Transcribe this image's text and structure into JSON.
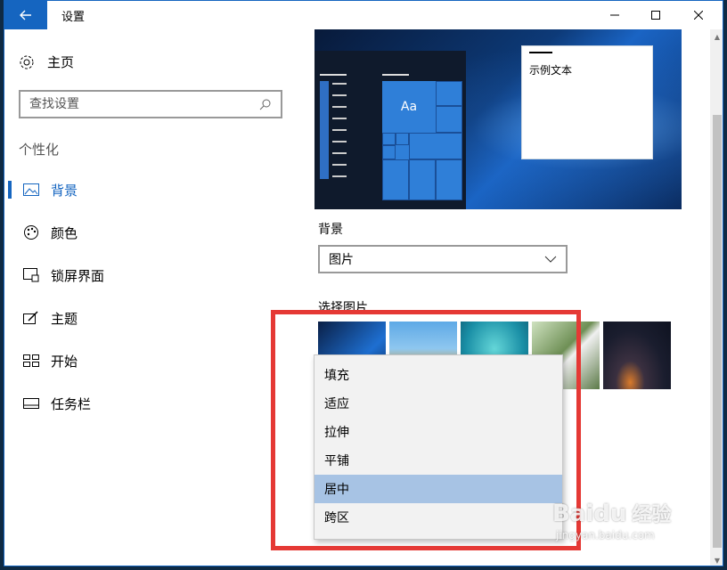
{
  "window": {
    "title": "设置"
  },
  "sidebar": {
    "home_label": "主页",
    "search_placeholder": "查找设置",
    "section_title": "个性化",
    "items": [
      {
        "label": "背景",
        "icon": "image-icon",
        "active": true
      },
      {
        "label": "颜色",
        "icon": "palette-icon",
        "active": false
      },
      {
        "label": "锁屏界面",
        "icon": "lock-screen-icon",
        "active": false
      },
      {
        "label": "主题",
        "icon": "theme-icon",
        "active": false
      },
      {
        "label": "开始",
        "icon": "start-icon",
        "active": false
      },
      {
        "label": "任务栏",
        "icon": "taskbar-icon",
        "active": false
      }
    ]
  },
  "main": {
    "preview": {
      "sample_text": "示例文本",
      "tile_text": "Aa"
    },
    "background_label": "背景",
    "background_value": "图片",
    "choose_picture_label": "选择图片",
    "fit_options": [
      "填充",
      "适应",
      "拉伸",
      "平铺",
      "居中",
      "跨区"
    ],
    "fit_selected": "居中"
  },
  "watermark": {
    "brand": "Baidu",
    "cn": "经验",
    "sub": "jingyan.baidu.com"
  },
  "colors": {
    "accent": "#1565c0",
    "highlight_border": "#e53935",
    "dropdown_selected": "#a7c3e4"
  }
}
